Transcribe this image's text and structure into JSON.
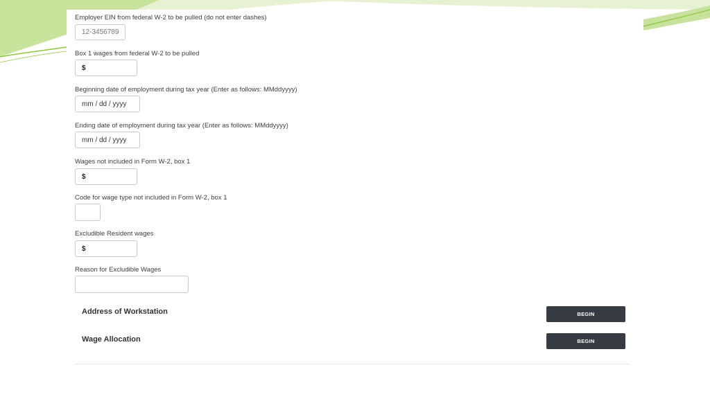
{
  "colors": {
    "accent_green": "#8dc63f",
    "light_green": "#c6e29b",
    "button_bg": "#363b44",
    "button_text": "#ffffff"
  },
  "fields": [
    {
      "label": "Employer EIN from federal W-2 to be pulled (do not enter dashes)",
      "placeholder": "12-3456789",
      "value": ""
    },
    {
      "label": "Box 1 wages from federal W-2 to be pulled",
      "value": "$"
    },
    {
      "label": "Beginning date of employment during tax year (Enter as follows: MMddyyyy)",
      "value": "mm / dd / yyyy"
    },
    {
      "label": "Ending date of employment during tax year (Enter as follows: MMddyyyy)",
      "value": "mm / dd / yyyy"
    },
    {
      "label": "Wages not included in Form W-2, box 1",
      "value": "$"
    },
    {
      "label": "Code for wage type not included in Form W-2, box 1",
      "value": ""
    },
    {
      "label": "Excludible Resident wages",
      "value": "$"
    },
    {
      "label": "Reason for Excludible Wages",
      "value": ""
    }
  ],
  "sections": [
    {
      "title": "Address of Workstation",
      "button_label": "BEGIN"
    },
    {
      "title": "Wage Allocation",
      "button_label": "BEGIN"
    }
  ]
}
